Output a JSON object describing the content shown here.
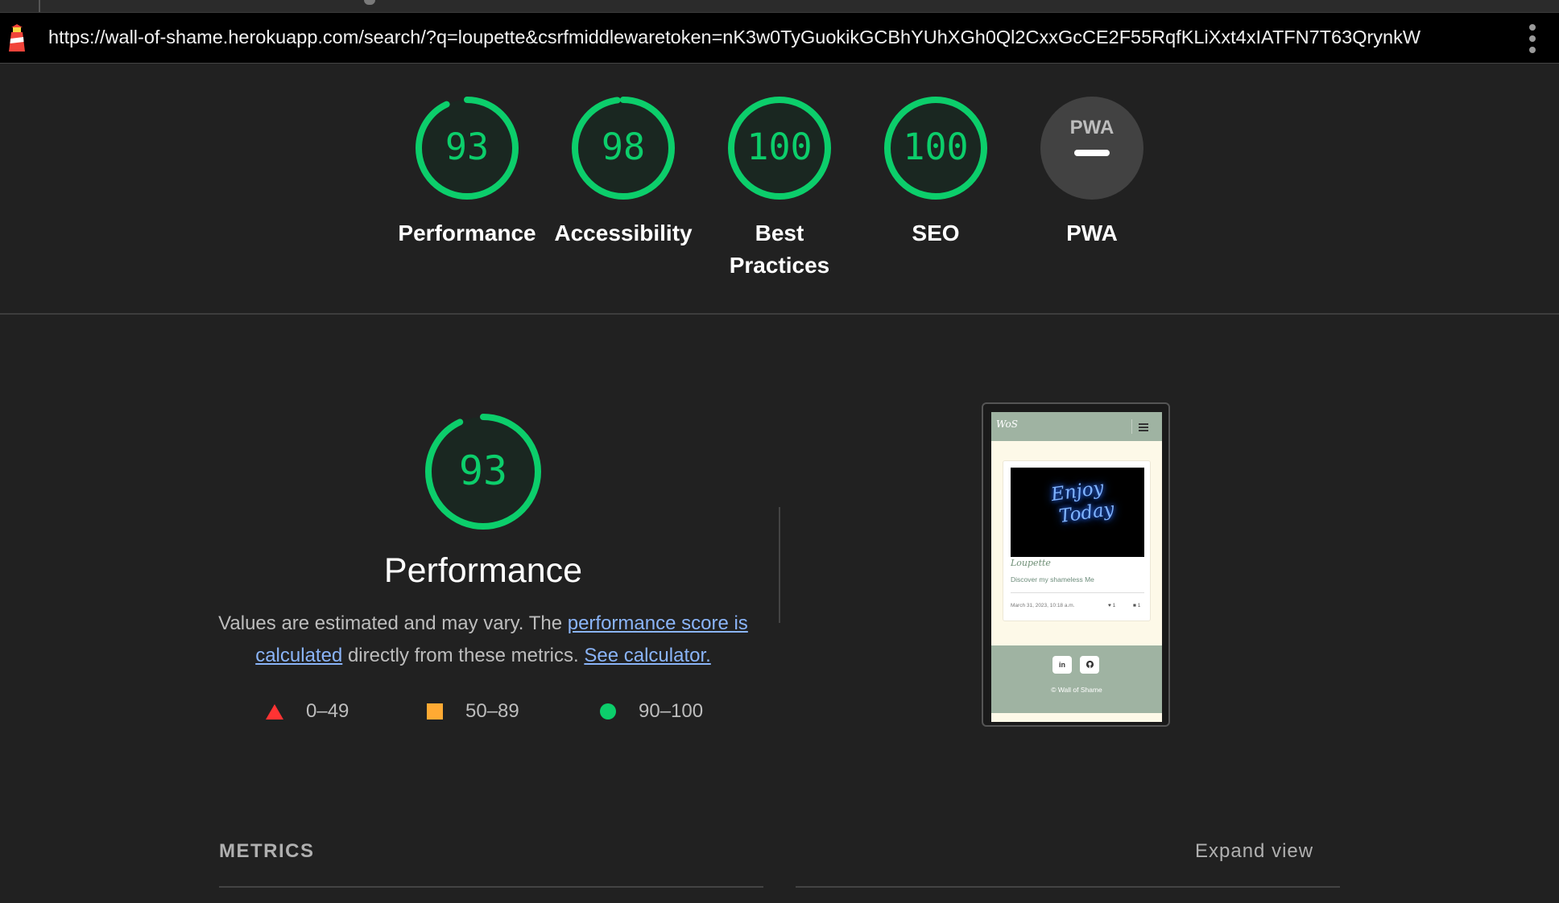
{
  "browser": {
    "url": "https://wall-of-shame.herokuapp.com/search/?q=loupette&csrfmiddlewaretoken=nK3w0TyGuokikGCBhYUhXGh0Ql2CxxGcCE2F55RqfKLiXxt4xIATFN7T63QrynkW",
    "menu_icon": "kebab-menu-icon",
    "logo_icon": "lighthouse-icon"
  },
  "gauges": [
    {
      "label": "Performance",
      "score": "93",
      "fraction": 0.93
    },
    {
      "label": "Accessibility",
      "score": "98",
      "fraction": 0.98
    },
    {
      "label": "Best Practices",
      "score": "100",
      "fraction": 1.0
    },
    {
      "label": "SEO",
      "score": "100",
      "fraction": 1.0
    },
    {
      "label": "PWA",
      "badge": "PWA",
      "status": "not-applicable"
    }
  ],
  "performance": {
    "score": "93",
    "fraction": 0.93,
    "title": "Performance",
    "desc_part1": "Values are estimated and may vary. The ",
    "link_score": "performance score is calculated",
    "desc_part2": " directly from these metrics. ",
    "link_calc": "See calculator."
  },
  "legend": [
    {
      "range": "0–49",
      "shape": "triangle",
      "color": "#ff3333"
    },
    {
      "range": "50–89",
      "shape": "square",
      "color": "#ffaa33"
    },
    {
      "range": "90–100",
      "shape": "circle",
      "color": "#0cce6b"
    }
  ],
  "screenshot": {
    "logo": "WoS",
    "neon_line1": "Enjoy",
    "neon_line2": "Today",
    "username": "Loupette",
    "description": "Discover my shameless Me",
    "date": "March 31, 2023, 10:18 a.m.",
    "likes": "1",
    "comments": "1",
    "social_linkedin": "in",
    "social_github": "github-icon",
    "footer": "© Wall of Shame"
  },
  "metrics": {
    "heading": "METRICS",
    "expand": "Expand view"
  },
  "colors": {
    "pass": "#0cce6b",
    "average": "#ffaa33",
    "fail": "#ff3333",
    "background": "#212121",
    "link": "#8ab4f8"
  }
}
